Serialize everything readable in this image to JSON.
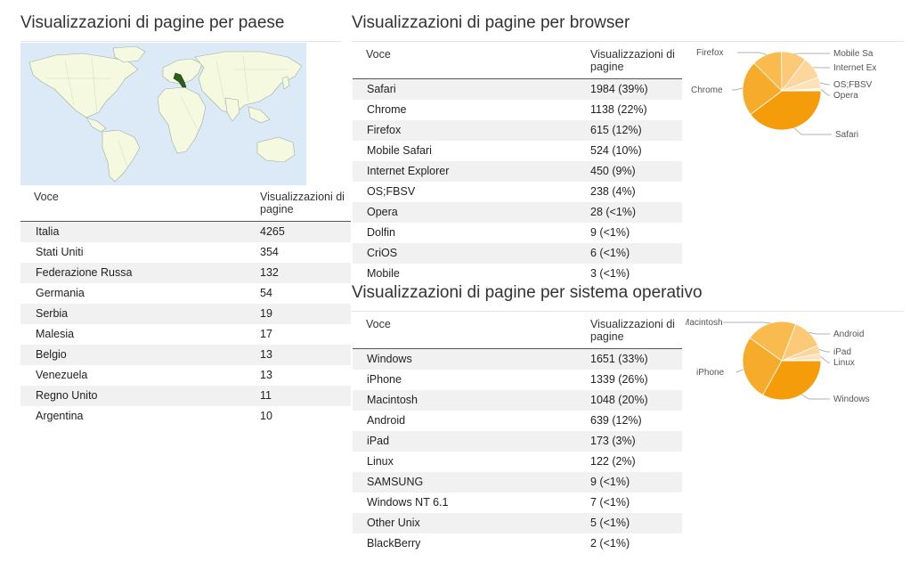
{
  "country": {
    "title": "Visualizzazioni di pagine per paese",
    "col_voce": "Voce",
    "col_views": "Visualizzazioni di pagine",
    "rows": [
      {
        "name": "Italia",
        "value": "4265"
      },
      {
        "name": "Stati Uniti",
        "value": "354"
      },
      {
        "name": "Federazione Russa",
        "value": "132"
      },
      {
        "name": "Germania",
        "value": "54"
      },
      {
        "name": "Serbia",
        "value": "19"
      },
      {
        "name": "Malesia",
        "value": "17"
      },
      {
        "name": "Belgio",
        "value": "13"
      },
      {
        "name": "Venezuela",
        "value": "13"
      },
      {
        "name": "Regno Unito",
        "value": "11"
      },
      {
        "name": "Argentina",
        "value": "10"
      }
    ]
  },
  "browser": {
    "title": "Visualizzazioni di pagine per browser",
    "col_voce": "Voce",
    "col_views": "Visualizzazioni di pagine",
    "rows": [
      {
        "name": "Safari",
        "value": "1984 (39%)"
      },
      {
        "name": "Chrome",
        "value": "1138 (22%)"
      },
      {
        "name": "Firefox",
        "value": "615 (12%)"
      },
      {
        "name": "Mobile Safari",
        "value": "524 (10%)"
      },
      {
        "name": "Internet Explorer",
        "value": "450 (9%)"
      },
      {
        "name": "OS;FBSV",
        "value": "238 (4%)"
      },
      {
        "name": "Opera",
        "value": "28 (<1%)"
      },
      {
        "name": "Dolfin",
        "value": "9 (<1%)"
      },
      {
        "name": "CriOS",
        "value": "6 (<1%)"
      },
      {
        "name": "Mobile",
        "value": "3 (<1%)"
      }
    ],
    "pie_labels": [
      "Safari",
      "Chrome",
      "Firefox",
      "Mobile Sa",
      "Internet Ex",
      "OS;FBSV",
      "Opera"
    ]
  },
  "os": {
    "title": "Visualizzazioni di pagine per sistema operativo",
    "col_voce": "Voce",
    "col_views": "Visualizzazioni di pagine",
    "rows": [
      {
        "name": "Windows",
        "value": "1651 (33%)"
      },
      {
        "name": "iPhone",
        "value": "1339 (26%)"
      },
      {
        "name": "Macintosh",
        "value": "1048 (20%)"
      },
      {
        "name": "Android",
        "value": "639 (12%)"
      },
      {
        "name": "iPad",
        "value": "173 (3%)"
      },
      {
        "name": "Linux",
        "value": "122 (2%)"
      },
      {
        "name": "SAMSUNG",
        "value": "9 (<1%)"
      },
      {
        "name": "Windows NT 6.1",
        "value": "7 (<1%)"
      },
      {
        "name": "Other Unix",
        "value": "5 (<1%)"
      },
      {
        "name": "BlackBerry",
        "value": "2 (<1%)"
      }
    ],
    "pie_labels": [
      "Windows",
      "iPhone",
      "Macintosh",
      "Android",
      "iPad",
      "Linux"
    ]
  },
  "chart_data": [
    {
      "type": "pie",
      "title": "",
      "categories": [
        "Safari",
        "Chrome",
        "Firefox",
        "Mobile Safari",
        "Internet Explorer",
        "OS;FBSV",
        "Opera",
        "Dolfin",
        "CriOS",
        "Mobile"
      ],
      "values": [
        1984,
        1138,
        615,
        524,
        450,
        238,
        28,
        9,
        6,
        3
      ]
    },
    {
      "type": "pie",
      "title": "",
      "categories": [
        "Windows",
        "iPhone",
        "Macintosh",
        "Android",
        "iPad",
        "Linux",
        "SAMSUNG",
        "Windows NT 6.1",
        "Other Unix",
        "BlackBerry"
      ],
      "values": [
        1651,
        1339,
        1048,
        639,
        173,
        122,
        9,
        7,
        5,
        2
      ]
    }
  ],
  "colors": {
    "pie": [
      "#f59c0a",
      "#f7ab2a",
      "#f9ba4e",
      "#fbc978",
      "#fcd69b",
      "#fde2b8",
      "#fee9c8",
      "#fef0d8",
      "#fff4e4",
      "#fff8ef"
    ],
    "map_land": "#f4f9e0",
    "map_water": "#dce9f6",
    "map_highlight": "#2e5e1a"
  }
}
